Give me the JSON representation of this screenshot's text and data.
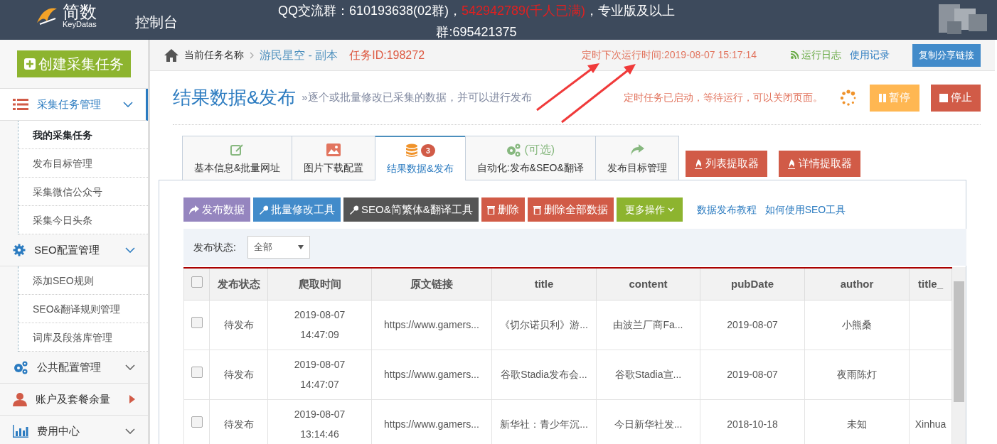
{
  "header": {
    "logo_text": "简数",
    "logo_sub": "KeyDatas",
    "console": "控制台",
    "notice": [
      {
        "text": "QQ交流群：610193638(02群)，",
        "highlight": false
      },
      {
        "text": "542942789(千人已满)",
        "highlight": true
      },
      {
        "text": "，专业版及以上群:695421375",
        "highlight": false
      }
    ]
  },
  "sidebar": {
    "create_button": "创建采集任务",
    "groups": [
      {
        "label": "采集任务管理",
        "active": true,
        "expanded": true,
        "children": [
          {
            "label": "我的采集任务",
            "selected": true
          },
          {
            "label": "发布目标管理",
            "selected": false
          },
          {
            "label": "采集微信公众号",
            "selected": false
          },
          {
            "label": "采集今日头条",
            "selected": false
          }
        ]
      },
      {
        "label": "SEO配置管理",
        "active": false,
        "expanded": true,
        "children": [
          {
            "label": "添加SEO规则",
            "selected": false
          },
          {
            "label": "SEO&翻译规则管理",
            "selected": false
          },
          {
            "label": "词库及段落库管理",
            "selected": false
          }
        ]
      },
      {
        "label": "公共配置管理",
        "active": false,
        "expanded": false
      },
      {
        "label": "账户及套餐余量",
        "active": false,
        "expanded": false
      },
      {
        "label": "费用中心",
        "active": false,
        "expanded": false
      }
    ]
  },
  "breadcrumb": {
    "label": "当前任务名称",
    "task": "游民星空 - 副本",
    "task_id": "任务ID:198272",
    "next_run": "定时下次运行时间:2019-08-07 15:17:14",
    "log_link": "运行日志",
    "usage_link": "使用记录",
    "share_button": "复制分享链接"
  },
  "page": {
    "title": "结果数据&发布",
    "subtitle": "»逐个或批量修改已采集的数据，并可以进行发布",
    "status": "定时任务已启动，等待运行，可以关闭页面。",
    "pause_button": "暂停",
    "stop_button": "停止"
  },
  "tabs": [
    {
      "label": "基本信息&批量网址",
      "selected": false
    },
    {
      "label": "图片下载配置",
      "selected": false
    },
    {
      "label": "结果数据&发布",
      "badge": "3",
      "selected": true
    },
    {
      "label": "自动化:发布&SEO&翻译",
      "icon_text": "(可选)",
      "selected": false
    },
    {
      "label": "发布目标管理",
      "selected": false
    }
  ],
  "extractor_buttons": [
    "列表提取器",
    "详情提取器"
  ],
  "toolbar": [
    {
      "label": "发布数据",
      "kind": "publish"
    },
    {
      "label": "批量修改工具",
      "kind": "edit"
    },
    {
      "label": "SEO&简繁体&翻译工具",
      "kind": "seo"
    },
    {
      "label": "删除",
      "kind": "delete"
    },
    {
      "label": "删除全部数据",
      "kind": "delete"
    },
    {
      "label": "更多操作",
      "kind": "more"
    }
  ],
  "help_links": [
    "数据发布教程",
    "如何使用SEO工具"
  ],
  "filter": {
    "label": "发布状态:",
    "value": "全部"
  },
  "table": {
    "select_all": {
      "checked": false
    },
    "columns": [
      "发布状态",
      "爬取时间",
      "原文链接",
      "title",
      "content",
      "pubDate",
      "author",
      "title_"
    ],
    "rows": [
      {
        "checked": false,
        "cells": [
          "待发布",
          [
            "2019-08-07",
            "14:47:09"
          ],
          "https://www.gamers...",
          "《切尔诺贝利》游...",
          "由波兰厂商Fa...",
          "2019-08-07",
          "小熊桑",
          ""
        ]
      },
      {
        "checked": false,
        "cells": [
          "待发布",
          [
            "2019-08-07",
            "14:47:07"
          ],
          "https://www.gamers...",
          "谷歌Stadia发布会...",
          "谷歌Stadia宣...",
          "2019-08-07",
          "夜雨陈灯",
          ""
        ]
      },
      {
        "checked": false,
        "cells": [
          "待发布",
          [
            "2019-08-07",
            "13:14:46"
          ],
          "https://www.gamers...",
          "新华社：青少年沉...",
          "今日新华社发...",
          "2018-10-18",
          "未知",
          "Xinhua"
        ]
      }
    ]
  }
}
